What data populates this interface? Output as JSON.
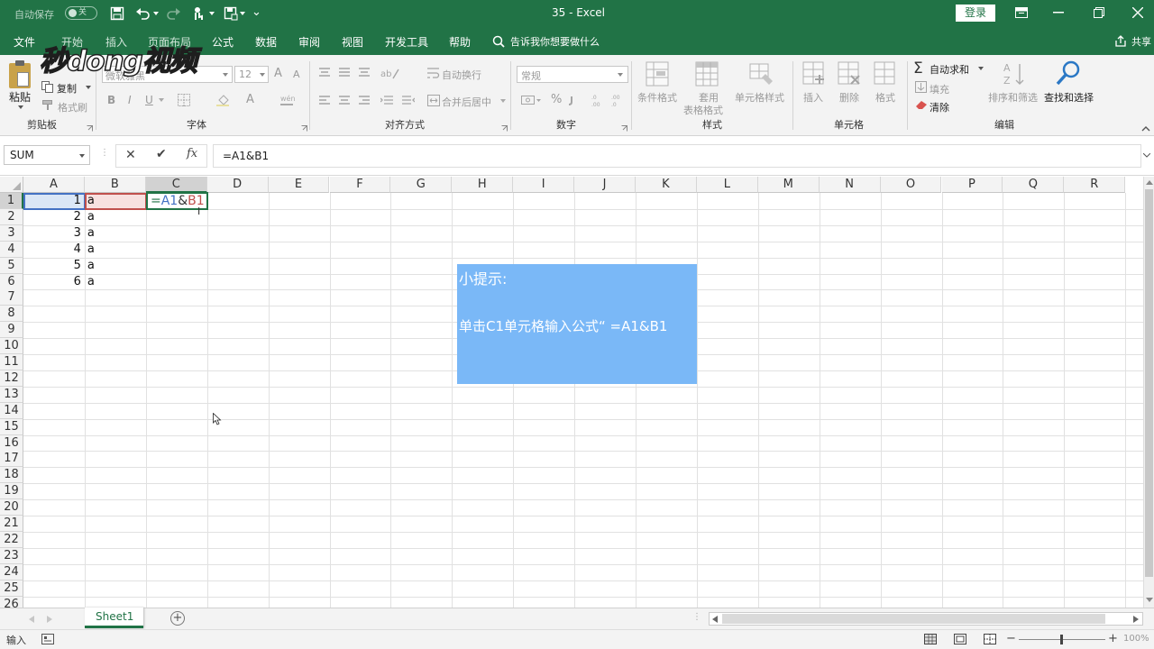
{
  "title_bar": {
    "autosave_label": "自动保存",
    "autosave_state": "关",
    "customize_glyph": "⌄",
    "doc_title": "35 - Excel",
    "login_button": "登录"
  },
  "watermark": "秒dong视频",
  "menu": {
    "tabs": [
      "文件",
      "开始",
      "插入",
      "页面布局",
      "公式",
      "数据",
      "审阅",
      "视图",
      "开发工具",
      "帮助"
    ],
    "tell_me": "告诉我你想要做什么",
    "share": "共享"
  },
  "ribbon": {
    "clipboard": {
      "paste": "粘贴",
      "copy": "复制",
      "format_painter": "格式刷",
      "group": "剪贴板"
    },
    "font": {
      "name": "微软雅黑",
      "size": "12",
      "bold": "B",
      "italic": "I",
      "underline": "U",
      "grow": "A",
      "shrink": "A",
      "font_color": "A",
      "group": "字体"
    },
    "alignment": {
      "wrap": "自动换行",
      "merge": "合并后居中",
      "group": "对齐方式"
    },
    "number": {
      "format": "常规",
      "percent": "%",
      "group": "数字"
    },
    "styles": {
      "conditional": "条件格式",
      "table_1": "套用",
      "table_2": "表格格式",
      "cell_styles": "单元格样式",
      "group": "样式"
    },
    "cells": {
      "insert": "插入",
      "delete": "删除",
      "format": "格式",
      "group": "单元格"
    },
    "editing": {
      "autosum": "自动求和",
      "fill": "填充",
      "clear": "清除",
      "sort": "排序和筛选",
      "find": "查找和选择",
      "group": "编辑"
    }
  },
  "formula_bar": {
    "name_box": "SUM",
    "cancel": "✕",
    "enter": "✔",
    "fx": "fx",
    "content": "=A1&B1"
  },
  "grid": {
    "columns": [
      "A",
      "B",
      "C",
      "D",
      "E",
      "F",
      "G",
      "H",
      "I",
      "J",
      "K",
      "L",
      "M",
      "N",
      "O",
      "P",
      "Q",
      "R"
    ],
    "rows": [
      "1",
      "2",
      "3",
      "4",
      "5",
      "6",
      "7",
      "8",
      "9",
      "10",
      "11",
      "12",
      "13",
      "14",
      "15",
      "16",
      "17",
      "18",
      "19",
      "20",
      "21",
      "22",
      "23",
      "24",
      "25",
      "26"
    ],
    "colA": [
      "1",
      "2",
      "3",
      "4",
      "5",
      "6"
    ],
    "colB": [
      "a",
      "a",
      "a",
      "a",
      "a",
      "a"
    ],
    "c1_eq": "=",
    "c1_a1": "A1",
    "c1_amp": "&",
    "c1_b1": "B1",
    "ref_colors": {
      "A1": "#4472c4",
      "B1": "#c0504d",
      "active": "#217346"
    }
  },
  "tip": {
    "heading": "小提示:",
    "body": "单击C1单元格输入公式“ =A1&B1"
  },
  "sheet_tabs": {
    "active": "Sheet1",
    "add": "+"
  },
  "status": {
    "mode": "输入",
    "zoom": "100%"
  }
}
